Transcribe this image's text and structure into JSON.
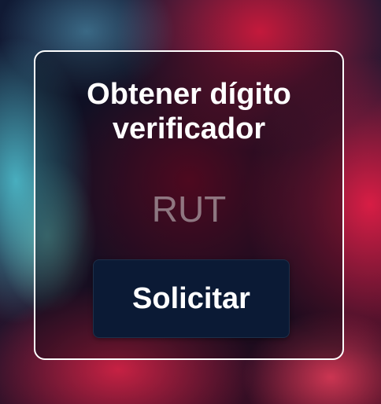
{
  "form": {
    "title_line1": "Obtener dígito",
    "title_line2": "verificador",
    "rut_placeholder": "RUT",
    "rut_value": "",
    "submit_label": "Solicitar"
  },
  "colors": {
    "card_border": "#ffffff",
    "button_background": "#0b1a35",
    "title_text": "#ffffff"
  }
}
